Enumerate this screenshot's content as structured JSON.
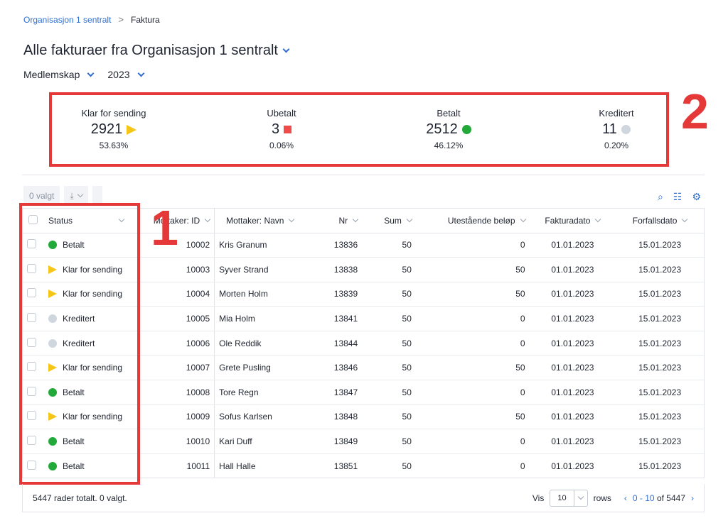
{
  "breadcrumb": {
    "parent": "Organisasjon 1 sentralt",
    "separator": ">",
    "current": "Faktura"
  },
  "title": "Alle fakturaer fra Organisasjon 1 sentralt",
  "filters": {
    "type": "Medlemskap",
    "year": "2023"
  },
  "stats": [
    {
      "label": "Klar for sending",
      "count": "2921",
      "pct": "53.63%",
      "marker": "yellow-arrow"
    },
    {
      "label": "Ubetalt",
      "count": "3",
      "pct": "0.06%",
      "marker": "red-square"
    },
    {
      "label": "Betalt",
      "count": "2512",
      "pct": "46.12%",
      "marker": "green-dot"
    },
    {
      "label": "Kreditert",
      "count": "11",
      "pct": "0.20%",
      "marker": "grey-dot"
    }
  ],
  "annotations": {
    "box1": "1",
    "box2": "2"
  },
  "toolbar": {
    "selected": "0 valgt",
    "icons": [
      "download-icon",
      "search-icon",
      "filter-sliders-icon",
      "settings-icon"
    ]
  },
  "columns": {
    "status": "Status",
    "id": "Mottaker: ID",
    "name": "Mottaker: Navn",
    "nr": "Nr",
    "sum": "Sum",
    "outstanding": "Utestående beløp",
    "invoice_date": "Fakturadato",
    "due_date": "Forfallsdato"
  },
  "colors": {
    "green": "#22a93a",
    "yellow": "#f5c518",
    "red": "#ef4b4b",
    "grey": "#d0d6de",
    "accent": "#2f6fd1",
    "annotation": "#e53939"
  },
  "rows": [
    {
      "status": "Betalt",
      "kind": "green",
      "id": "10002",
      "name": "Kris Granum",
      "nr": "13836",
      "sum": "50",
      "outstanding": "0",
      "invoice_date": "01.01.2023",
      "due_date": "15.01.2023"
    },
    {
      "status": "Klar for sending",
      "kind": "yellow",
      "id": "10003",
      "name": "Syver Strand",
      "nr": "13838",
      "sum": "50",
      "outstanding": "50",
      "invoice_date": "01.01.2023",
      "due_date": "15.01.2023"
    },
    {
      "status": "Klar for sending",
      "kind": "yellow",
      "id": "10004",
      "name": "Morten Holm",
      "nr": "13839",
      "sum": "50",
      "outstanding": "50",
      "invoice_date": "01.01.2023",
      "due_date": "15.01.2023"
    },
    {
      "status": "Kreditert",
      "kind": "grey",
      "id": "10005",
      "name": "Mia Holm",
      "nr": "13841",
      "sum": "50",
      "outstanding": "0",
      "invoice_date": "01.01.2023",
      "due_date": "15.01.2023"
    },
    {
      "status": "Kreditert",
      "kind": "grey",
      "id": "10006",
      "name": "Ole Reddik",
      "nr": "13844",
      "sum": "50",
      "outstanding": "0",
      "invoice_date": "01.01.2023",
      "due_date": "15.01.2023"
    },
    {
      "status": "Klar for sending",
      "kind": "yellow",
      "id": "10007",
      "name": "Grete Pusling",
      "nr": "13846",
      "sum": "50",
      "outstanding": "50",
      "invoice_date": "01.01.2023",
      "due_date": "15.01.2023"
    },
    {
      "status": "Betalt",
      "kind": "green",
      "id": "10008",
      "name": "Tore Regn",
      "nr": "13847",
      "sum": "50",
      "outstanding": "0",
      "invoice_date": "01.01.2023",
      "due_date": "15.01.2023"
    },
    {
      "status": "Klar for sending",
      "kind": "yellow",
      "id": "10009",
      "name": "Sofus Karlsen",
      "nr": "13848",
      "sum": "50",
      "outstanding": "50",
      "invoice_date": "01.01.2023",
      "due_date": "15.01.2023"
    },
    {
      "status": "Betalt",
      "kind": "green",
      "id": "10010",
      "name": "Kari Duff",
      "nr": "13849",
      "sum": "50",
      "outstanding": "0",
      "invoice_date": "01.01.2023",
      "due_date": "15.01.2023"
    },
    {
      "status": "Betalt",
      "kind": "green",
      "id": "10011",
      "name": "Hall Halle",
      "nr": "13851",
      "sum": "50",
      "outstanding": "0",
      "invoice_date": "01.01.2023",
      "due_date": "15.01.2023"
    }
  ],
  "footer": {
    "total": "5447 rader totalt. 0 valgt.",
    "show": "Vis",
    "per_page": "10",
    "rows_label": "rows",
    "range": "0 - 10",
    "of_text": "of 5447"
  }
}
